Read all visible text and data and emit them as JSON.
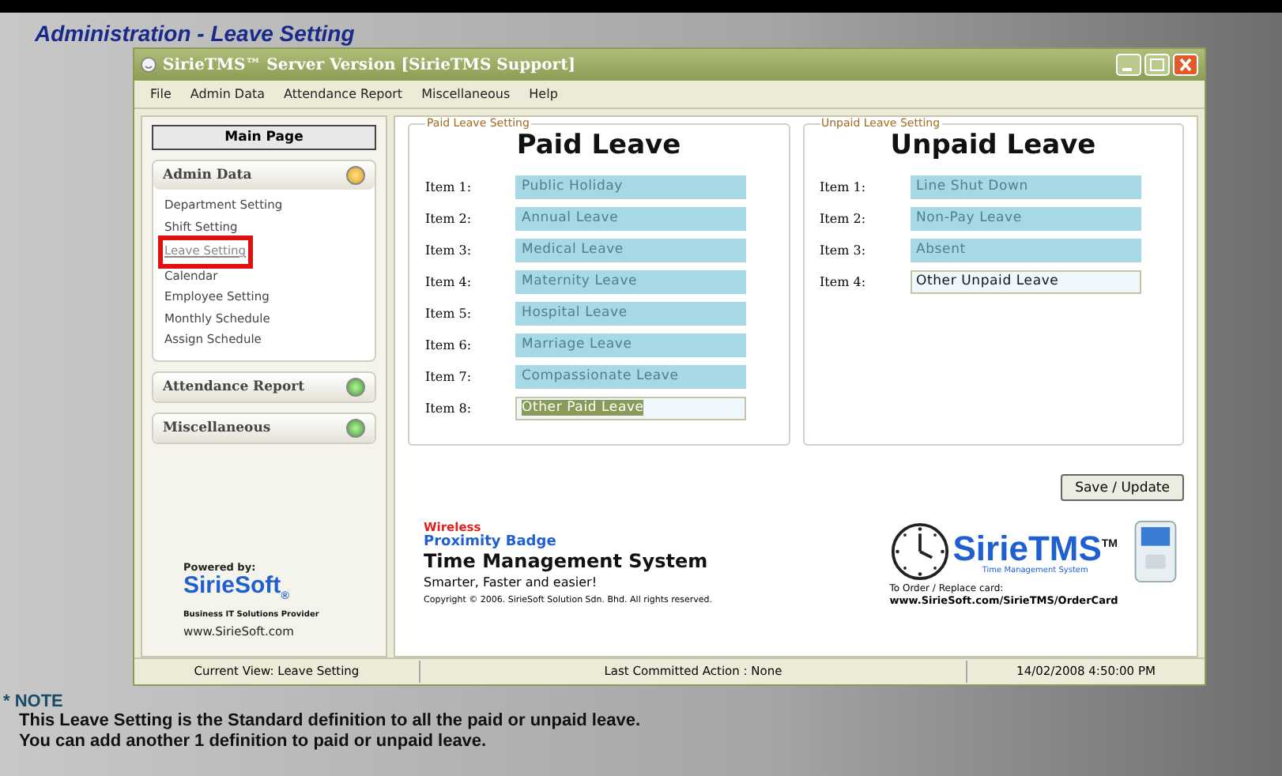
{
  "page_title": "Administration - Leave Setting",
  "window": {
    "title": "SirieTMS™ Server Version [SirieTMS Support]"
  },
  "menu": [
    "File",
    "Admin Data",
    "Attendance Report",
    "Miscellaneous",
    "Help"
  ],
  "sidebar": {
    "main_button": "Main Page",
    "sections": [
      {
        "title": "Admin Data",
        "expanded": true,
        "items": [
          {
            "label": "Department Setting",
            "selected": false
          },
          {
            "label": "Shift Setting",
            "selected": false
          },
          {
            "label": "Leave Setting",
            "selected": true
          },
          {
            "label": "Calendar",
            "selected": false
          },
          {
            "label": "Employee Setting",
            "selected": false
          },
          {
            "label": "Monthly Schedule",
            "selected": false
          },
          {
            "label": "Assign Schedule",
            "selected": false
          }
        ]
      },
      {
        "title": "Attendance Report",
        "expanded": false
      },
      {
        "title": "Miscellaneous",
        "expanded": false
      }
    ],
    "powered_by": "Powered by:",
    "brand": "SirieSoft",
    "brand_mark": "®",
    "brand_tagline": "Business IT Solutions Provider",
    "website": "www.SirieSoft.com"
  },
  "groups": [
    {
      "legend": "Paid Leave Setting",
      "heading": "Paid Leave",
      "items": [
        {
          "label": "Item 1:",
          "value": "Public Holiday",
          "disabled": true,
          "highlighted": false
        },
        {
          "label": "Item 2:",
          "value": "Annual Leave",
          "disabled": true,
          "highlighted": false
        },
        {
          "label": "Item 3:",
          "value": "Medical Leave",
          "disabled": true,
          "highlighted": false
        },
        {
          "label": "Item 4:",
          "value": "Maternity Leave",
          "disabled": true,
          "highlighted": false
        },
        {
          "label": "Item 5:",
          "value": "Hospital Leave",
          "disabled": true,
          "highlighted": false
        },
        {
          "label": "Item 6:",
          "value": "Marriage Leave",
          "disabled": true,
          "highlighted": false
        },
        {
          "label": "Item 7:",
          "value": "Compassionate Leave",
          "disabled": true,
          "highlighted": false
        },
        {
          "label": "Item 8:",
          "value": "Other Paid Leave",
          "disabled": false,
          "highlighted": true
        }
      ]
    },
    {
      "legend": "Unpaid Leave Setting",
      "heading": "Unpaid Leave",
      "items": [
        {
          "label": "Item 1:",
          "value": "Line Shut Down",
          "disabled": true,
          "highlighted": false
        },
        {
          "label": "Item 2:",
          "value": "Non-Pay Leave",
          "disabled": true,
          "highlighted": false
        },
        {
          "label": "Item 3:",
          "value": "Absent",
          "disabled": true,
          "highlighted": false
        },
        {
          "label": "Item 4:",
          "value": "Other Unpaid Leave",
          "disabled": false,
          "highlighted": false
        }
      ]
    }
  ],
  "save_button": "Save / Update",
  "banner": {
    "wireless": "Wireless",
    "badge": "Proximity Badge",
    "title": "Time Management System",
    "slogan": "Smarter, Faster and easier!",
    "copyright": "Copyright © 2006. SirieSoft Solution Sdn. Bhd. All rights reserved.",
    "logo": "SirieTMS",
    "logo_tm": "TM",
    "logo_tagline": "Time Management System",
    "order_label": "To Order / Replace card:",
    "order_url": "www.SirieSoft.com/SirieTMS/OrderCard"
  },
  "status_bar": [
    "Current View: Leave Setting",
    "Last Committed Action : None",
    "14/02/2008 4:50:00 PM"
  ],
  "note": {
    "title": "* NOTE",
    "lines": [
      "This Leave Setting is the Standard definition to all the paid or unpaid leave.",
      "You can add another 1 definition to paid or unpaid leave."
    ]
  }
}
